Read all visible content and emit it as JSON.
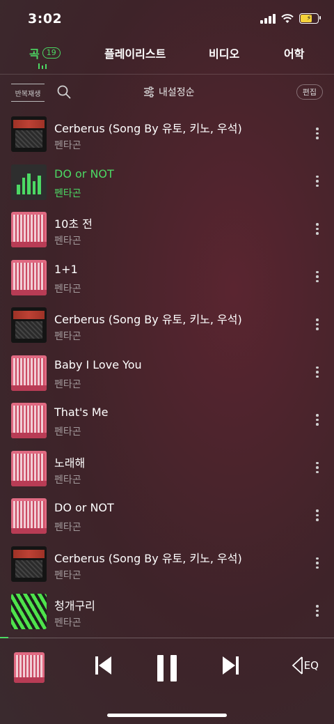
{
  "status": {
    "time": "3:02"
  },
  "tabs": {
    "song": "곡",
    "song_count": "19",
    "playlist": "플레이리스트",
    "video": "비디오",
    "language": "어학"
  },
  "toolbar": {
    "repeat": "반복재생",
    "sort": "내설정순",
    "edit": "편집"
  },
  "songs": [
    {
      "title": "Cerberus (Song By 유토, 키노, 우석)",
      "artist": "펜타곤",
      "art": "dark"
    },
    {
      "title": "DO or NOT",
      "artist": "펜타곤",
      "art": "playing"
    },
    {
      "title": "10초 전",
      "artist": "펜타곤",
      "art": "pink"
    },
    {
      "title": "1+1",
      "artist": "펜타곤",
      "art": "pink"
    },
    {
      "title": "Cerberus (Song By 유토, 키노, 우석)",
      "artist": "펜타곤",
      "art": "dark"
    },
    {
      "title": "Baby I Love You",
      "artist": "펜타곤",
      "art": "pink"
    },
    {
      "title": "That's Me",
      "artist": "펜타곤",
      "art": "pink"
    },
    {
      "title": "노래해",
      "artist": "펜타곤",
      "art": "pink"
    },
    {
      "title": "DO or NOT",
      "artist": "펜타곤",
      "art": "pink"
    },
    {
      "title": "Cerberus (Song By 유토, 키노, 우석)",
      "artist": "펜타곤",
      "art": "dark"
    },
    {
      "title": "청개구리",
      "artist": "펜타곤",
      "art": "green"
    }
  ],
  "player": {
    "eq": "EQ",
    "progress": 0.025
  },
  "colors": {
    "accent": "#4cd964",
    "background": "#3e2329"
  }
}
